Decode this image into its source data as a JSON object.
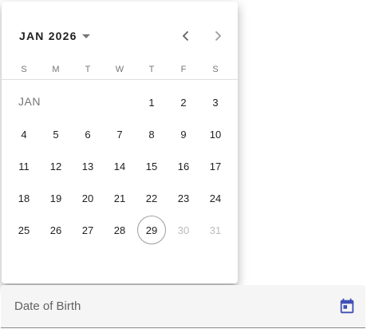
{
  "calendar": {
    "period_label": "JAN 2026",
    "month_label": "JAN",
    "weekdays": [
      "S",
      "M",
      "T",
      "W",
      "T",
      "F",
      "S"
    ],
    "weeks": [
      [
        "",
        "",
        "",
        "",
        "1",
        "2",
        "3"
      ],
      [
        "4",
        "5",
        "6",
        "7",
        "8",
        "9",
        "10"
      ],
      [
        "11",
        "12",
        "13",
        "14",
        "15",
        "16",
        "17"
      ],
      [
        "18",
        "19",
        "20",
        "21",
        "22",
        "23",
        "24"
      ],
      [
        "25",
        "26",
        "27",
        "28",
        "29",
        "30",
        "31"
      ]
    ],
    "today": "29",
    "disabled_days": [
      "30",
      "31"
    ],
    "icons": {
      "period_toggle": "caret-down-icon",
      "previous": "chevron-left-icon",
      "next": "chevron-right-icon"
    }
  },
  "field": {
    "label": "Date of Birth",
    "toggle_icon": "calendar-icon"
  },
  "colors": {
    "accent": "#3f51b5",
    "today_border": "#9e9e9e",
    "disabled_text": "#bdbdbd",
    "field_background": "#f5f5f5"
  }
}
